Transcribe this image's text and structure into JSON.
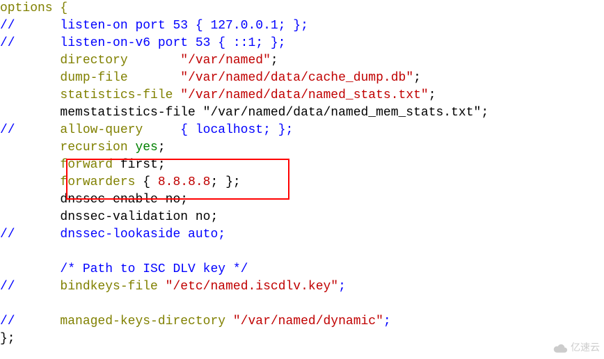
{
  "watermark": "亿速云",
  "config": {
    "open": "options {",
    "l1_cmt": "//",
    "l1": "listen-on port 53 { 127.0.0.1; };",
    "l2_cmt": "//",
    "l2": "listen-on-v6 port 53 { ::1; };",
    "dir_k": "directory",
    "dir_v": "\"/var/named\"",
    "dump_k": "dump-file",
    "dump_v": "\"/var/named/data/cache_dump.db\"",
    "stats_k": "statistics-file",
    "stats_v": "\"/var/named/data/named_stats.txt\"",
    "memstats": "memstatistics-file \"/var/named/data/named_mem_stats.txt\";",
    "aq_cmt": "//",
    "aq_k": "allow-query",
    "aq_v": "{ localhost; };",
    "rec_k": "recursion",
    "rec_v": "yes",
    "fwd_k": "forward",
    "fwd_v": "first;",
    "fwds_k": "forwarders",
    "fwds_b1": "{ ",
    "fwds_ip": "8.8.8.8",
    "fwds_b2": "; };",
    "de": "dnssec-enable no;",
    "dv": "dnssec-validation no;",
    "dl_cmt": "//",
    "dl": "dnssec-lookaside auto;",
    "path_comment": "/* Path to ISC DLV key */",
    "bk_cmt": "//",
    "bk_k": "bindkeys-file",
    "bk_v": "\"/etc/named.iscdlv.key\"",
    "mk_cmt": "//",
    "mk_k": "managed-keys-directory",
    "mk_v": "\"/var/named/dynamic\"",
    "close": "};"
  }
}
